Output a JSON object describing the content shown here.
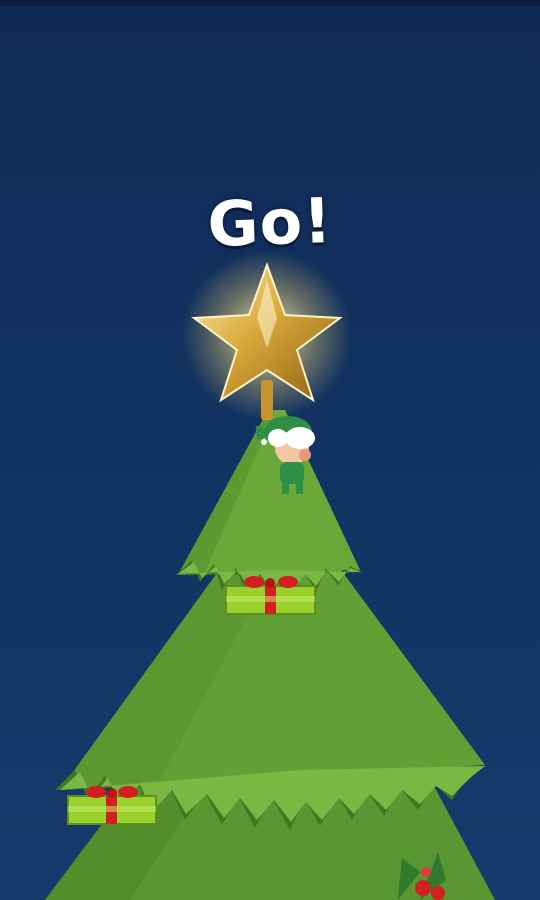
{
  "hud": {
    "status_text": "Go!"
  },
  "scene": {
    "objects": [
      {
        "name": "star-topper",
        "icon": "star-icon"
      },
      {
        "name": "elf-character",
        "icon": "elf-icon"
      },
      {
        "name": "gift-upper",
        "icon": "gift-icon"
      },
      {
        "name": "gift-left",
        "icon": "gift-icon"
      },
      {
        "name": "holly",
        "icon": "holly-icon"
      }
    ]
  },
  "colors": {
    "sky": "#123463",
    "tree": "#5e9b34",
    "tree_dark": "#3f7a22",
    "gift_box": "#8fd12a",
    "ribbon": "#d21f1f",
    "star": "#d8b04c"
  }
}
